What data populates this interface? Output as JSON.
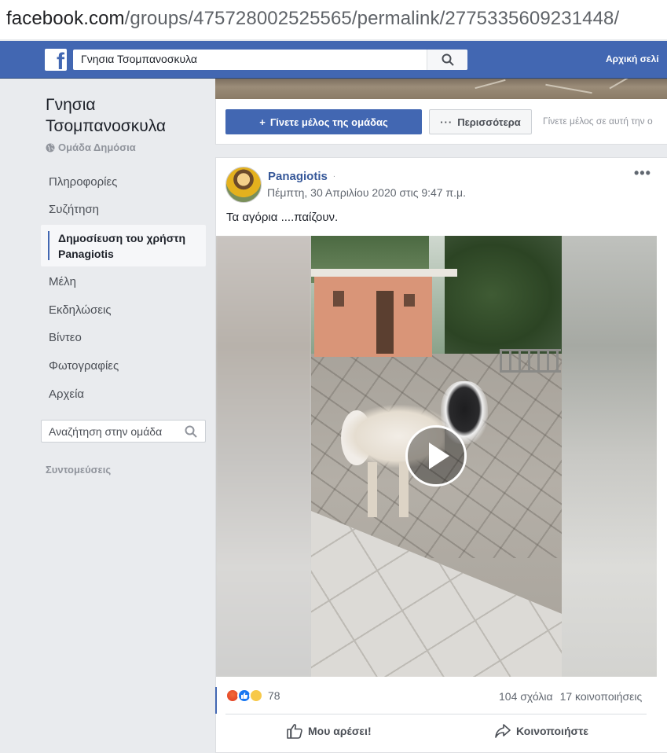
{
  "browser": {
    "url_domain": "facebook.com",
    "url_path": "/groups/475728002525565/permalink/2775335609231448/"
  },
  "header": {
    "search_value": "Γνησια Τσομπανοσκυλα",
    "home_link": "Αρχική σελί"
  },
  "group": {
    "title": "Γνησια Τσομπανοσκυλα",
    "privacy": "Ομάδα Δημόσια"
  },
  "sidebar": {
    "items": [
      {
        "label": "Πληροφορίες"
      },
      {
        "label": "Συζήτηση"
      },
      {
        "label": "Δημοσίευση του χρήστη Panagiotis"
      },
      {
        "label": "Μέλη"
      },
      {
        "label": "Εκδηλώσεις"
      },
      {
        "label": "Βίντεο"
      },
      {
        "label": "Φωτογραφίες"
      },
      {
        "label": "Αρχεία"
      }
    ],
    "search_placeholder": "Αναζήτηση στην ομάδα",
    "shortcuts_label": "Συντομεύσεις"
  },
  "cover": {
    "join_button": "Γίνετε μέλος της ομάδας",
    "more_button": "Περισσότερα",
    "join_hint": "Γίνετε μέλος σε αυτή την ο"
  },
  "post": {
    "author": "Panagiotis",
    "timestamp": "Πέμπτη, 30 Απριλίου 2020 στις 9:47 π.μ.",
    "text": "Τα αγόρια ....παίζουν.",
    "reaction_count": "78",
    "comments": "104 σχόλια",
    "shares": "17 κοινοποιήσεις",
    "like_button": "Μου αρέσει!",
    "share_button": "Κοινοποιήστε",
    "reactions": [
      "angry-icon",
      "like-icon",
      "sad-icon"
    ]
  },
  "colors": {
    "brand": "#4267b2",
    "link": "#365899"
  }
}
